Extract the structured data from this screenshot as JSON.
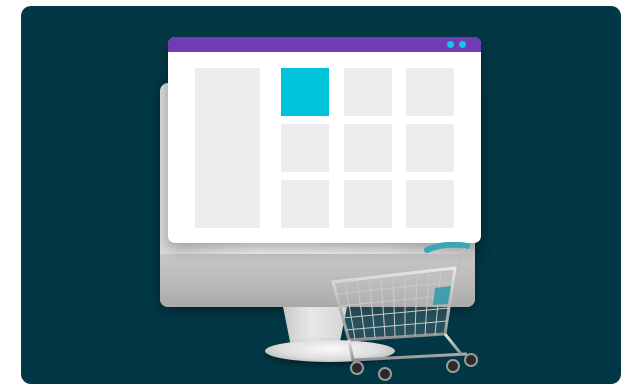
{
  "scene": {
    "background_color": "#023845",
    "titlebar_color": "#6f3cb4",
    "accent_color": "#00c4dc",
    "placeholder_color": "#ececec"
  },
  "window": {
    "controls": [
      "window-dot-icon",
      "window-dot-icon"
    ],
    "grid": {
      "rows": 3,
      "columns": 3,
      "highlighted_tile": "row-1-col-1"
    }
  },
  "illustration": {
    "objects": [
      "monitor",
      "browser-window",
      "shopping-cart-icon"
    ]
  }
}
